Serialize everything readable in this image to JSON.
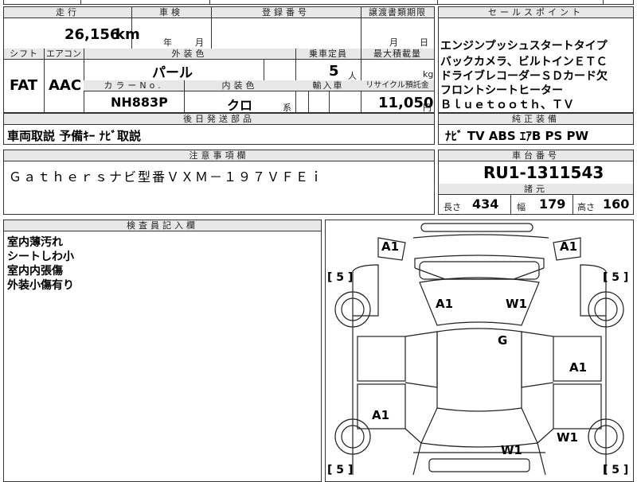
{
  "mileage": {
    "label": "走行",
    "value": "26,156",
    "unit": "km"
  },
  "inspection": {
    "label": "車検",
    "year_unit": "年",
    "month_unit": "月"
  },
  "registration": {
    "label": "登録番号"
  },
  "transfer_deadline": {
    "label": "譲渡書類期限",
    "month_unit": "月",
    "day_unit": "日"
  },
  "sales_points": {
    "label": "セールスポイント",
    "lines": [
      "エンジンプッシュスタートタイプ",
      "バックカメラ、ビルトインＥＴＣ",
      "ドライブレコーダーＳＤカード欠",
      "フロントシートヒーター",
      "Ｂｌｕｅｔｏｏｔｈ、ＴＶ"
    ]
  },
  "shift": {
    "label": "シフト",
    "value": "FAT"
  },
  "aircon": {
    "label": "エアコン",
    "value": "AAC"
  },
  "exterior_color": {
    "label": "外装色",
    "value": "パール"
  },
  "capacity": {
    "label": "乗車定員",
    "value": "5",
    "unit": "人"
  },
  "max_load": {
    "label": "最大積載量",
    "unit": "kg"
  },
  "color_no": {
    "label": "カラーNo.",
    "value": "NH883P"
  },
  "interior_color": {
    "label": "内装色",
    "value": "クロ",
    "suffix": "系"
  },
  "import": {
    "label": "輸入車"
  },
  "recycle": {
    "label": "リサイクル預託金",
    "value": "11,050",
    "unit": "円"
  },
  "later_parts": {
    "label": "後日発送部品",
    "value": "車両取説 予備ｷｰ ﾅﾋﾞ取説"
  },
  "equipment": {
    "label": "純正装備",
    "value": "ﾅﾋﾞ TV ABS ｴｱB PS PW"
  },
  "notes": {
    "label": "注意事項欄",
    "value": "Ｇａｔｈｅｒｓナビ型番ＶＸＭ－１９７ＶＦＥｉ"
  },
  "chassis": {
    "label": "車台番号",
    "value": "RU1-1311543"
  },
  "specs": {
    "label": "諸元",
    "length_label": "長さ",
    "length": "434",
    "width_label": "幅",
    "width": "179",
    "height_label": "高さ",
    "height": "160"
  },
  "inspector": {
    "label": "検査員記入欄",
    "lines": [
      "室内薄汚れ",
      "シートしわ小",
      "室内内張傷",
      "外装小傷有り"
    ]
  },
  "diagram": {
    "marks": [
      "A1",
      "A1",
      "A1",
      "W1",
      "G",
      "A1",
      "A1",
      "W1",
      "W1"
    ],
    "tires": [
      "[ 5 ]",
      "[ 5 ]",
      "[ 5 ]",
      "[ 5 ]"
    ]
  }
}
